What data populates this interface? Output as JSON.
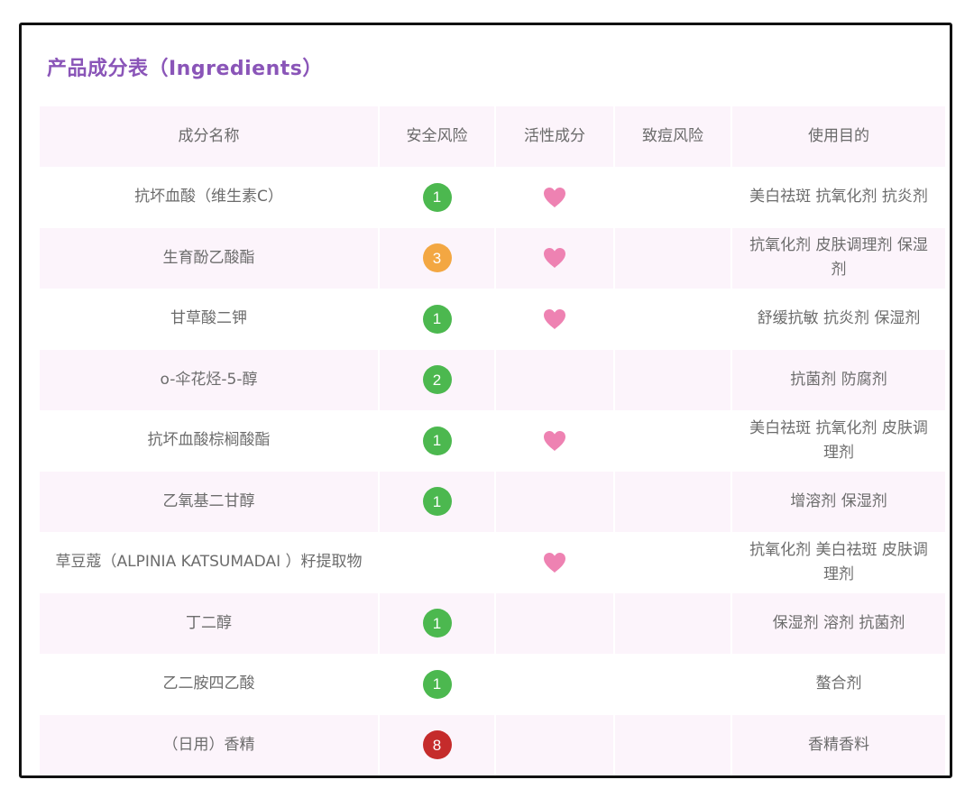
{
  "title": "产品成分表（Ingredients）",
  "headers": {
    "name": "成分名称",
    "risk": "安全风险",
    "active": "活性成分",
    "acne": "致痘风险",
    "purpose": "使用目的"
  },
  "colors": {
    "title": "#8a55b8",
    "heart": "#ee82b2",
    "risk_low": "#4cb84f",
    "risk_mid": "#f3a742",
    "risk_high": "#c52b2b",
    "row_alt": "#fcf4fb"
  },
  "icon": "heart-icon",
  "rows": [
    {
      "name": "抗坏血酸（维生素C）",
      "risk": "1",
      "active": true,
      "acne": "",
      "purpose": "美白祛斑 抗氧化剂 抗炎剂"
    },
    {
      "name": "生育酚乙酸酯",
      "risk": "3",
      "active": true,
      "acne": "",
      "purpose": "抗氧化剂 皮肤调理剂 保湿剂"
    },
    {
      "name": "甘草酸二钾",
      "risk": "1",
      "active": true,
      "acne": "",
      "purpose": "舒缓抗敏 抗炎剂 保湿剂"
    },
    {
      "name": "o-伞花烃-5-醇",
      "risk": "2",
      "active": false,
      "acne": "",
      "purpose": "抗菌剂 防腐剂"
    },
    {
      "name": "抗坏血酸棕榈酸酯",
      "risk": "1",
      "active": true,
      "acne": "",
      "purpose": "美白祛斑 抗氧化剂 皮肤调理剂"
    },
    {
      "name": "乙氧基二甘醇",
      "risk": "1",
      "active": false,
      "acne": "",
      "purpose": "增溶剂 保湿剂"
    },
    {
      "name": "草豆蔻（ALPINIA KATSUMADAI ）籽提取物",
      "risk": "",
      "active": true,
      "acne": "",
      "purpose": "抗氧化剂 美白祛斑 皮肤调理剂"
    },
    {
      "name": "丁二醇",
      "risk": "1",
      "active": false,
      "acne": "",
      "purpose": "保湿剂 溶剂 抗菌剂"
    },
    {
      "name": "乙二胺四乙酸",
      "risk": "1",
      "active": false,
      "acne": "",
      "purpose": "螯合剂"
    },
    {
      "name": "（日用）香精",
      "risk": "8",
      "active": false,
      "acne": "",
      "purpose": "香精香料"
    }
  ]
}
